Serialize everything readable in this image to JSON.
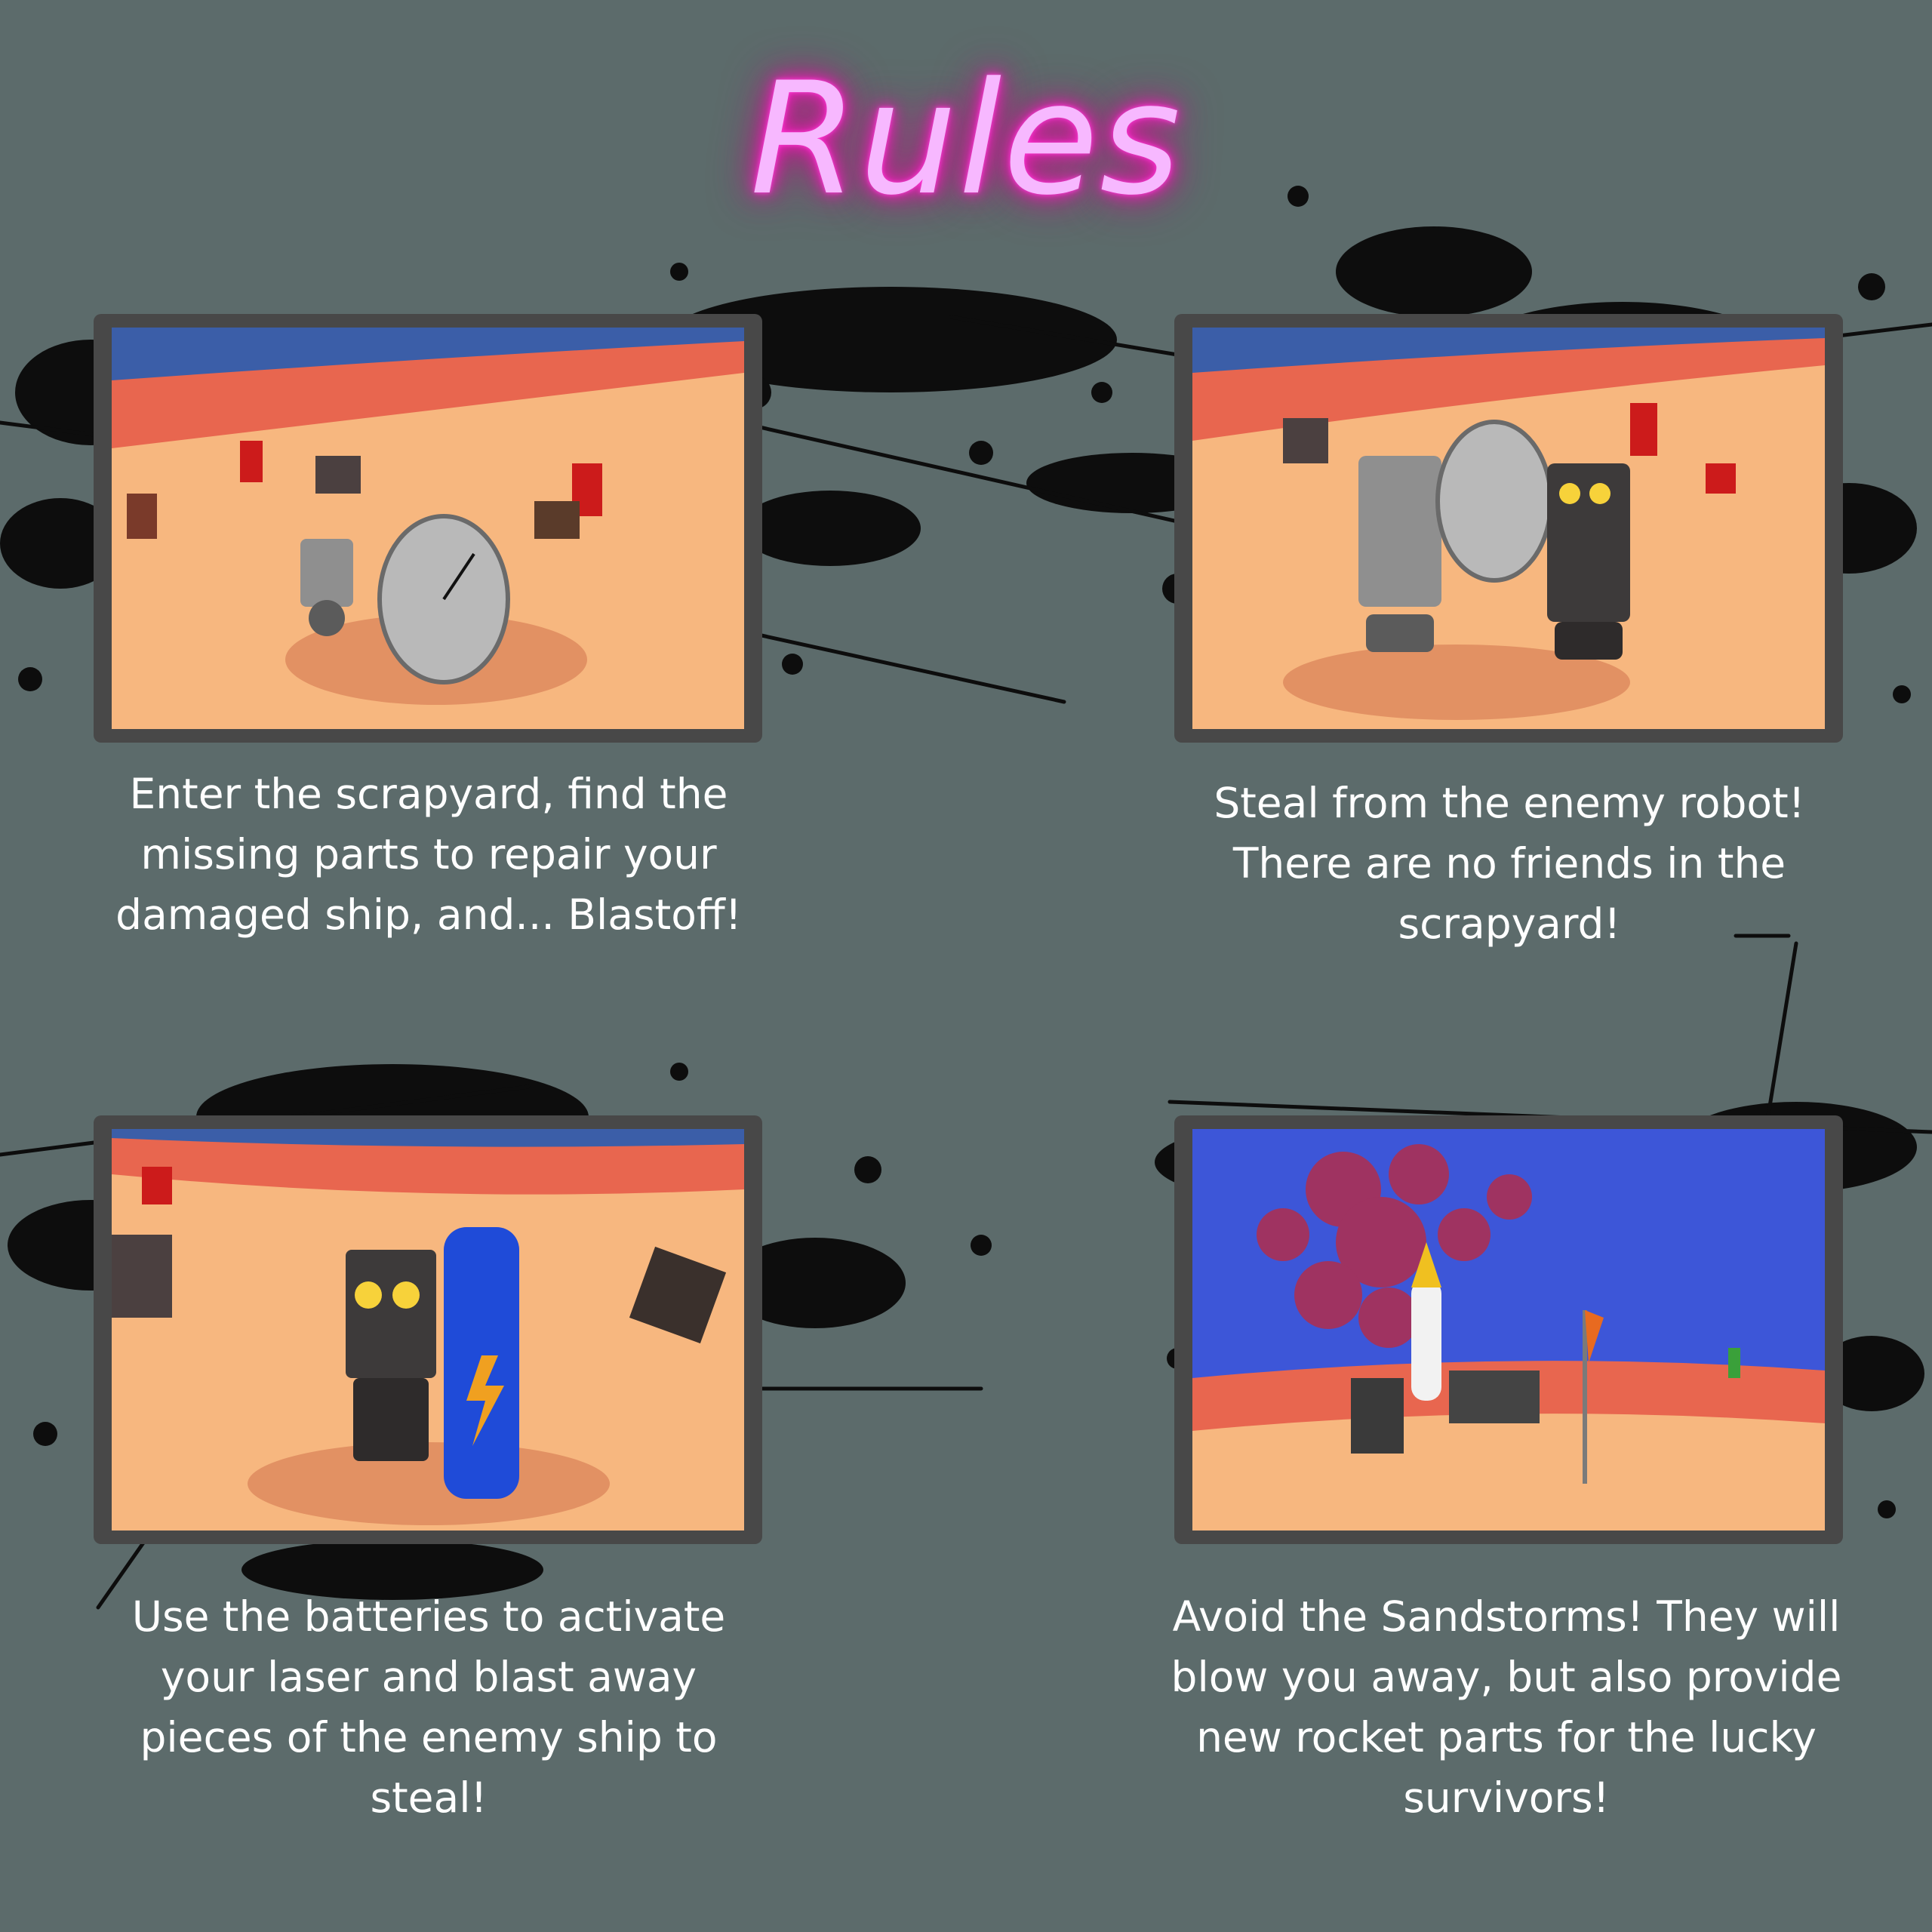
{
  "title": "Rules",
  "colors": {
    "background": "#5c6b6b",
    "title_glow": "#ff1ec8",
    "panel_frame": "#484848",
    "caption_text": "#ffffff"
  },
  "rules": [
    {
      "caption": "Enter the scrapyard, find the missing parts to repair your damaged ship, and... Blastoff!",
      "image": "robot-with-satellite-dish-screenshot"
    },
    {
      "caption": "Steal from the enemy robot! There are no friends in the scrapyard!",
      "image": "two-robots-fighting-screenshot"
    },
    {
      "caption": "Use the batteries to activate your laser and blast away pieces of the enemy ship to steal!",
      "image": "robot-with-battery-screenshot"
    },
    {
      "caption": "Avoid the Sandstorms! They will blow you away, but also provide new rocket parts for the lucky survivors!",
      "image": "rocket-and-sandstorm-screenshot"
    }
  ]
}
